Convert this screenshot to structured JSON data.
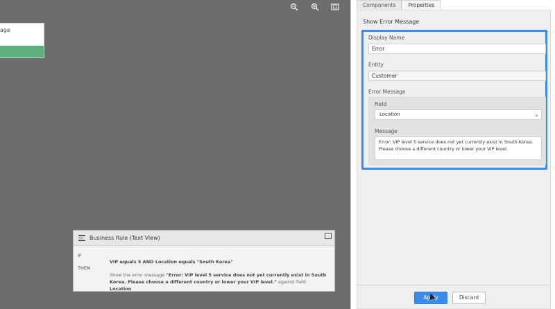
{
  "canvas": {
    "node_card_text": "age",
    "toolbar": {
      "zoom_out_icon": "zoom-out-icon",
      "zoom_in_icon": "zoom-in-icon",
      "fit_icon": "fit-screen-icon"
    },
    "business_rule": {
      "title": "Business Rule (Text View)",
      "if_label": "IF",
      "then_label": "THEN",
      "condition": "VIP equals 5 AND Location equals \"South Korea\"",
      "action_prefix": "Show the error message ",
      "action_message": "\"Error: VIP level 5 service does not yet currently exist in South Korea. Please choose a different country or lower your VIP level.\"",
      "action_suffix": " against field ",
      "action_field": "Location"
    }
  },
  "right_panel": {
    "tabs": [
      {
        "label": "Components",
        "active": false
      },
      {
        "label": "Properties",
        "active": true
      }
    ],
    "section_title": "Show Error Message",
    "display_name_label": "Display Name",
    "display_name_value": "Error",
    "entity_label": "Entity",
    "entity_value": "Customer",
    "error_message_label": "Error Message",
    "field_label": "Field",
    "field_value": "Location",
    "message_label": "Message",
    "message_value": "Error: VIP level 5 service does not yet currently exist in South Korea. Please choose a different country or lower your VIP level.",
    "apply_label": "Apply",
    "discard_label": "Discard"
  },
  "colors": {
    "accent": "#3b8ce9",
    "canvas_bg": "#6d6d6d",
    "node_bar": "#5db07d"
  }
}
